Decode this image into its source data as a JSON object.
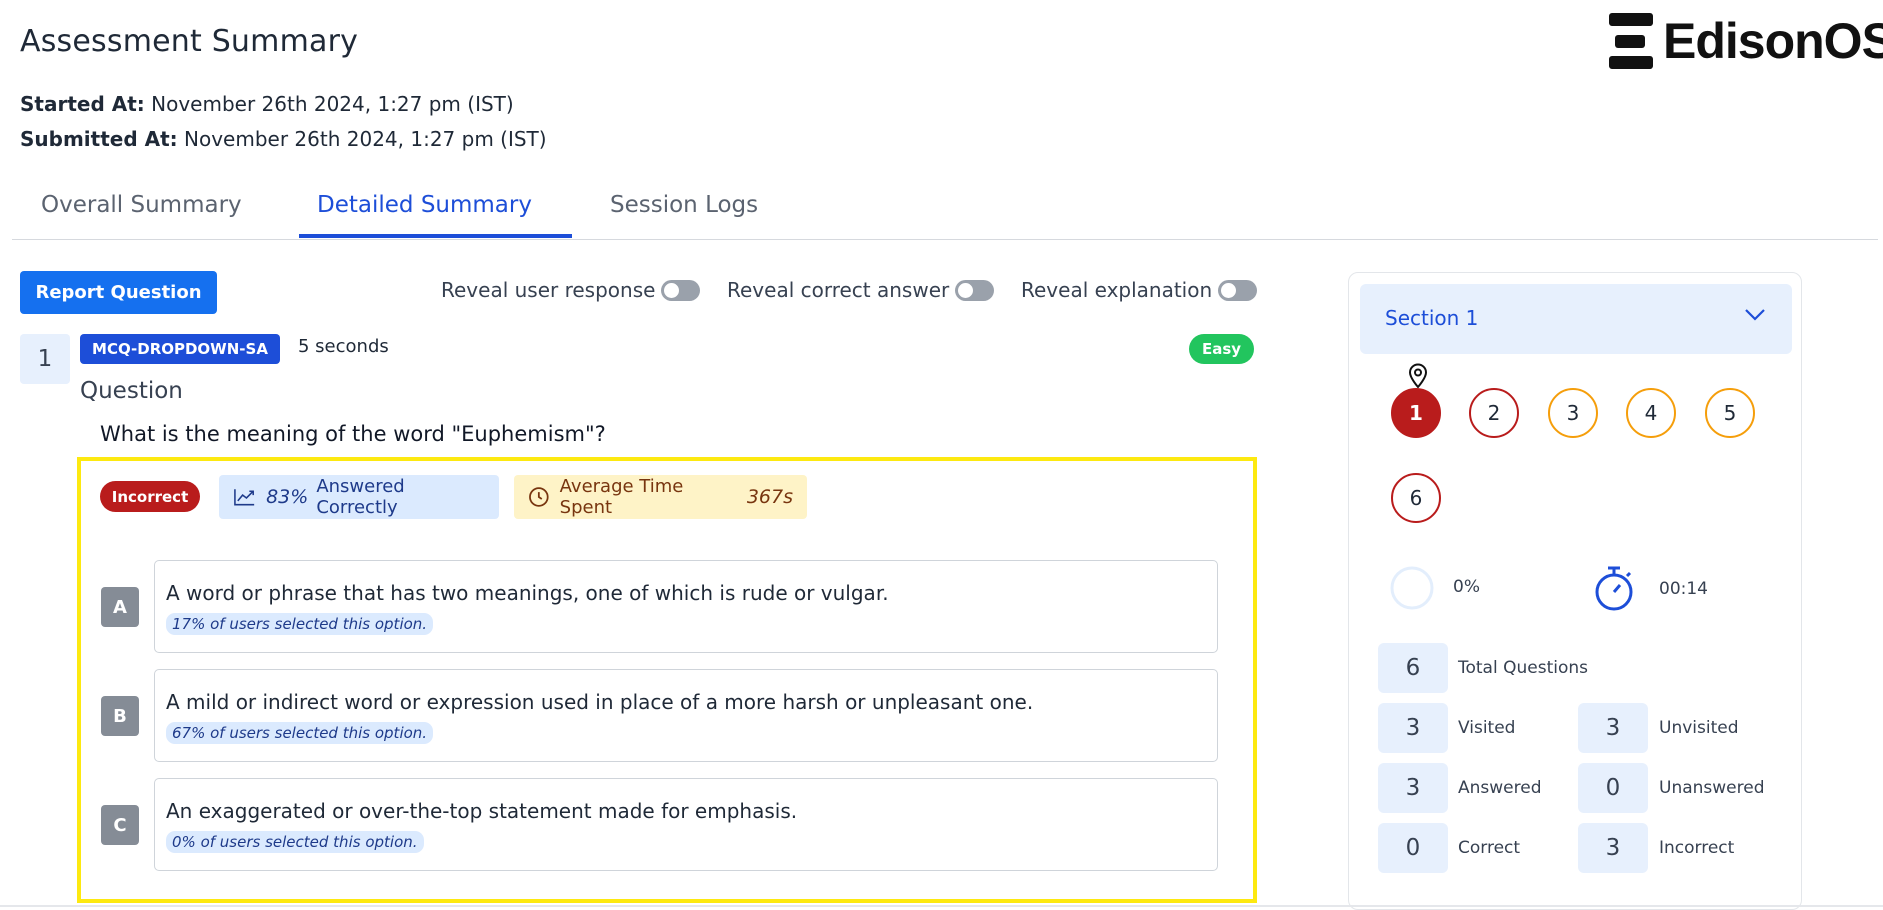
{
  "header": {
    "title": "Assessment Summary",
    "logo_text": "EdisonOS",
    "started_label": "Started At:",
    "started_value": "November 26th 2024, 1:27 pm (IST)",
    "submitted_label": "Submitted At:",
    "submitted_value": "November 26th 2024, 1:27 pm (IST)"
  },
  "tabs": [
    {
      "label": "Overall Summary",
      "active": false
    },
    {
      "label": "Detailed Summary",
      "active": true
    },
    {
      "label": "Session Logs",
      "active": false
    }
  ],
  "toolbar": {
    "report_label": "Report Question",
    "toggles": [
      {
        "label": "Reveal user response",
        "on": false
      },
      {
        "label": "Reveal correct answer",
        "on": false
      },
      {
        "label": "Reveal explanation",
        "on": false
      }
    ]
  },
  "question": {
    "number": "1",
    "type": "MCQ-DROPDOWN-SA",
    "time": "5 seconds",
    "difficulty": "Easy",
    "heading": "Question",
    "text": "What is the meaning of the word \"Euphemism\"?",
    "result": "Incorrect",
    "correct_pct": "83%",
    "correct_label": "Answered Correctly",
    "avg_time_label": "Average Time Spent",
    "avg_time_value": "367s",
    "options": [
      {
        "letter": "A",
        "text": "A word or phrase that has two meanings, one of which is rude or vulgar.",
        "pct": "17% of users selected this option."
      },
      {
        "letter": "B",
        "text": "A mild or indirect word or expression used in place of a more harsh or unpleasant one.",
        "pct": "67% of users selected this option."
      },
      {
        "letter": "C",
        "text": "An exaggerated or over-the-top statement made for emphasis.",
        "pct": "0% of users selected this option."
      }
    ]
  },
  "sidebar": {
    "section_label": "Section 1",
    "questions": [
      {
        "n": "1",
        "state": "current"
      },
      {
        "n": "2",
        "state": "incorrect"
      },
      {
        "n": "3",
        "state": "unvisited"
      },
      {
        "n": "4",
        "state": "unvisited"
      },
      {
        "n": "5",
        "state": "unvisited"
      },
      {
        "n": "6",
        "state": "incorrect"
      }
    ],
    "progress": "0%",
    "timer": "00:14",
    "stats": {
      "total": {
        "value": "6",
        "label": "Total Questions"
      },
      "visited": {
        "value": "3",
        "label": "Visited"
      },
      "unvisited": {
        "value": "3",
        "label": "Unvisited"
      },
      "answered": {
        "value": "3",
        "label": "Answered"
      },
      "unanswered": {
        "value": "0",
        "label": "Unanswered"
      },
      "correct": {
        "value": "0",
        "label": "Correct"
      },
      "incorrect": {
        "value": "3",
        "label": "Incorrect"
      }
    }
  },
  "colors": {
    "primary": "#1d4ed8",
    "button": "#1570ef",
    "incorrect": "#b91c1c",
    "easy": "#22c55e",
    "highlight": "#fde910",
    "unvisited": "#f59e0b"
  }
}
